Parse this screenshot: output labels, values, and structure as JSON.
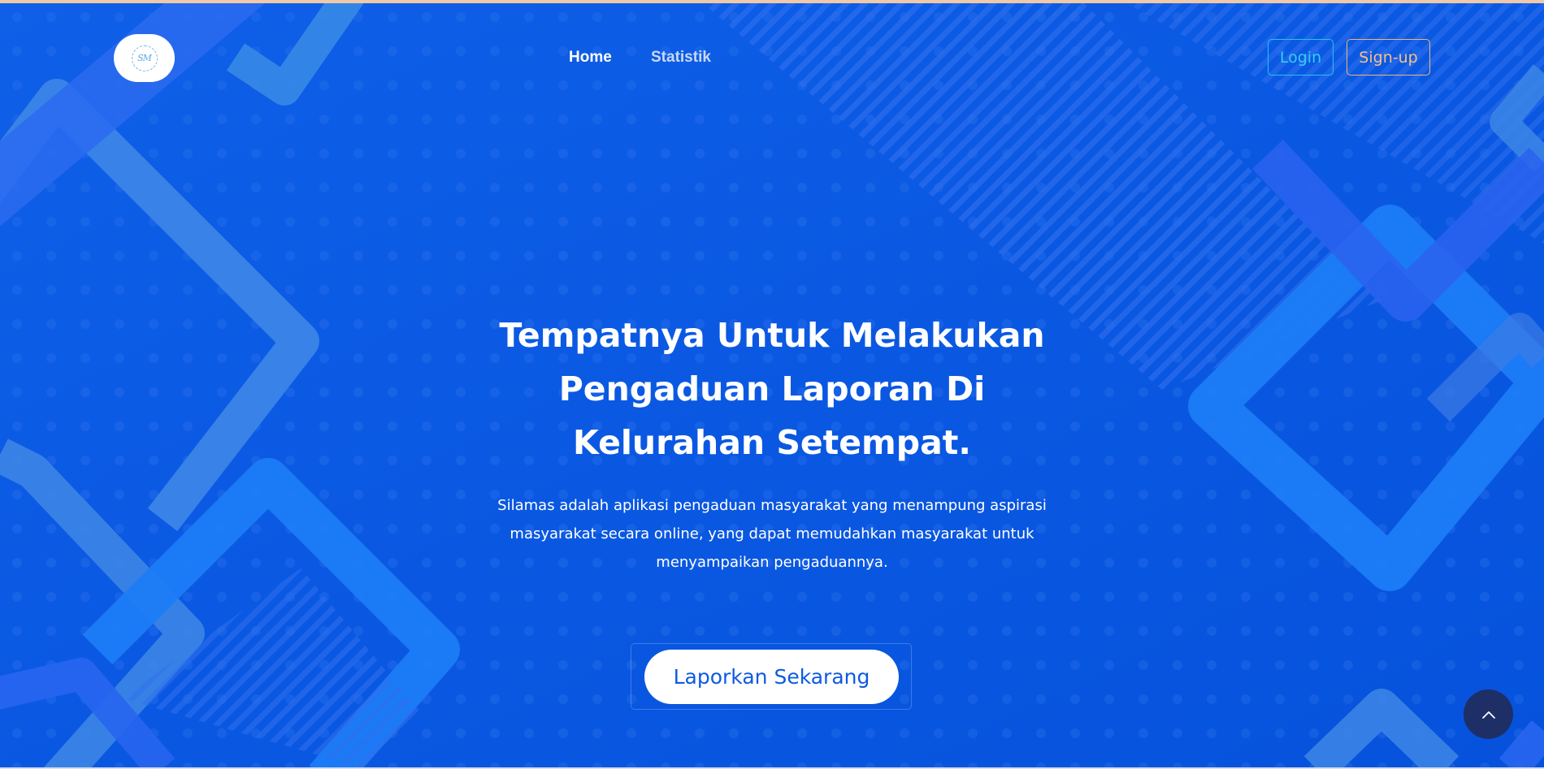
{
  "nav": {
    "logo_text": "SM",
    "home": "Home",
    "statistik": "Statistik",
    "login": "Login",
    "signup": "Sign-up"
  },
  "hero": {
    "title_line1": "Tempatnya Untuk Melakukan",
    "title_line2": "Pengaduan Laporan Di",
    "title_line3": "Kelurahan Setempat.",
    "description": "Silamas adalah aplikasi pengaduan masyarakat yang menampung aspirasi masyarakat secara online, yang dapat memudahkan masyarakat untuk menyampaikan pengaduannya.",
    "cta_label": "Laporkan Sekarang"
  },
  "icons": {
    "scroll_top": "chevron-up-icon",
    "logo": "silamas-logo"
  },
  "colors": {
    "background": "#0a5ae6",
    "login_accent": "#35cdf3",
    "signup_accent": "#f7c086",
    "cta_text": "#0d5be1",
    "scroll_top_bg": "#1d2f66",
    "top_strip": "#f0c9a8"
  }
}
